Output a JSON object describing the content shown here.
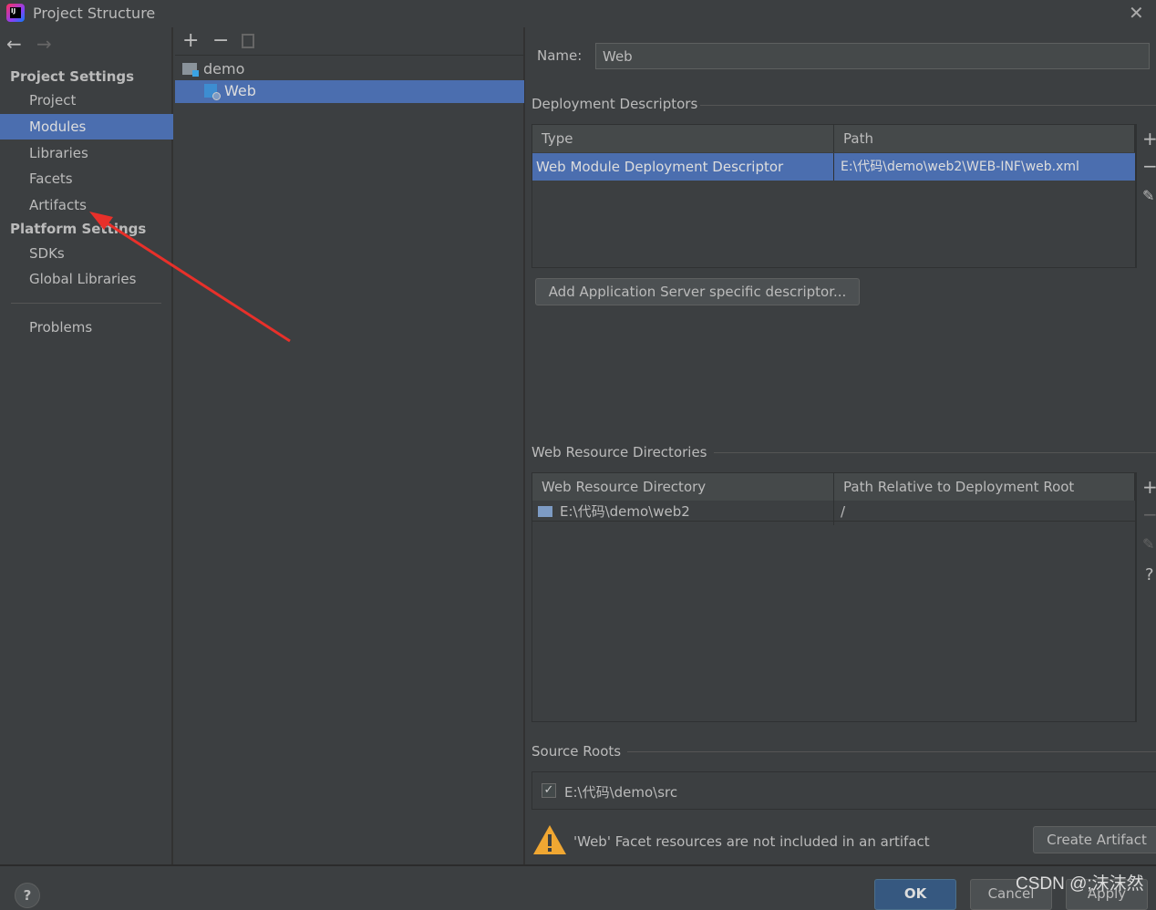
{
  "window": {
    "title": "Project Structure"
  },
  "sidebar": {
    "section1": "Project Settings",
    "items1": [
      "Project",
      "Modules",
      "Libraries",
      "Facets",
      "Artifacts"
    ],
    "section2": "Platform Settings",
    "items2": [
      "SDKs",
      "Global Libraries"
    ],
    "problems": "Problems",
    "selected": "Modules"
  },
  "tree": {
    "items": [
      {
        "label": "demo"
      },
      {
        "label": "Web"
      }
    ]
  },
  "name_field": {
    "label": "Name:",
    "value": "Web"
  },
  "deployment": {
    "title": "Deployment Descriptors",
    "columns": [
      "Type",
      "Path"
    ],
    "rows": [
      [
        "Web Module Deployment Descriptor",
        "E:\\代码\\demo\\web2\\WEB-INF\\web.xml"
      ]
    ],
    "add_button": "Add Application Server specific descriptor..."
  },
  "resources": {
    "title": "Web Resource Directories",
    "columns": [
      "Web Resource Directory",
      "Path Relative to Deployment Root"
    ],
    "rows": [
      [
        "E:\\代码\\demo\\web2",
        "/"
      ]
    ]
  },
  "source_roots": {
    "title": "Source Roots",
    "items": [
      {
        "path": "E:\\代码\\demo\\src",
        "checked": true
      }
    ]
  },
  "warning": {
    "text": "'Web' Facet resources are not included in an artifact",
    "button": "Create Artifact"
  },
  "footer": {
    "ok": "OK",
    "cancel": "Cancel",
    "apply": "Apply",
    "help": "?"
  },
  "watermark": "CSDN @;沫沫然",
  "colors": {
    "selection": "#4b6eaf",
    "annotation_arrow": "#e8302a",
    "warning": "#f0a732"
  }
}
